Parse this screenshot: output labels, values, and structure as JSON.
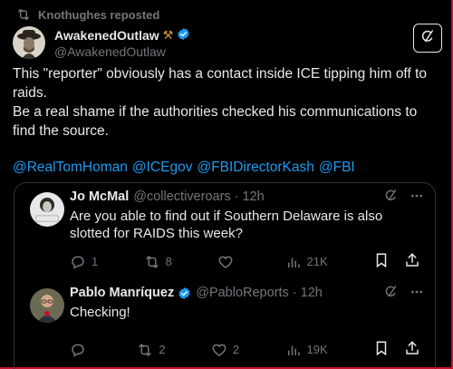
{
  "repost": {
    "label": "Knothughes reposted",
    "icon": "repost-icon"
  },
  "post": {
    "author_name": "AwakenedOutlaw",
    "author_emoji": "⚒",
    "verified": true,
    "handle": "@AwakenedOutlaw",
    "paragraph_1": "This \"reporter\" obviously has a contact inside ICE tipping him off to raids.",
    "paragraph_2": "Be a real shame if the authorities checked his communications to find the source.",
    "mentions": [
      "@RealTomHoman",
      "@ICEgov",
      "@FBIDirectorKash",
      "@FBI"
    ]
  },
  "replies": [
    {
      "name": "Jo McMal",
      "handle": "@collectiveroars",
      "time": "12h",
      "verified": false,
      "text": "Are you able to find out if Southern Delaware is also slotted for RAIDS this week?",
      "counts": {
        "replies": "1",
        "reposts": "8",
        "likes": "",
        "views": "21K"
      }
    },
    {
      "name": "Pablo Manríquez",
      "handle": "@PabloReports",
      "time": "12h",
      "verified": true,
      "text": "Checking!",
      "counts": {
        "replies": "",
        "reposts": "2",
        "likes": "2",
        "views": "19K"
      }
    }
  ],
  "colors": {
    "background": "#000000",
    "text": "#e7e9ea",
    "muted": "#71767b",
    "link": "#1d9bf0",
    "verified": "#1d9bf0",
    "border": "#2f3336",
    "frame": "#c8102e"
  }
}
